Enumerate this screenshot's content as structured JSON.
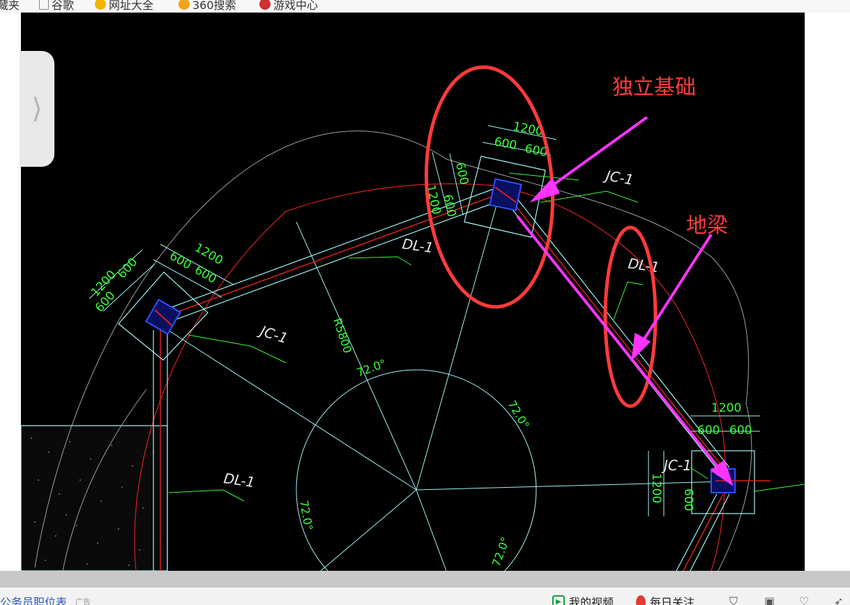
{
  "bookmarks": [
    {
      "label": "藏夹",
      "icon": "star-icon"
    },
    {
      "label": "谷歌",
      "icon": "doc-icon"
    },
    {
      "label": "网址大全",
      "icon": "globe-icon"
    },
    {
      "label": "360搜索",
      "icon": "search-icon"
    },
    {
      "label": "游戏中心",
      "icon": "game-icon"
    }
  ],
  "cad": {
    "dim_1200": "1200",
    "dim_600": "600",
    "label_jc": "JC-1",
    "label_dl": "DL-1",
    "radius_label": "R5800",
    "angle_label": "72.0°"
  },
  "annotations": {
    "foundation": "独立基础",
    "beam": "地梁"
  },
  "status": {
    "link_text": "公务员职位表",
    "ad_badge": "广告",
    "video": "我的视频",
    "follow": "每日关注"
  },
  "colors": {
    "annotation_red": "#ff3b3b",
    "arrow_magenta": "#ff33ff",
    "cad_cyan": "#9ff5f5",
    "cad_green": "#39ff39",
    "cad_red": "#d92020"
  }
}
